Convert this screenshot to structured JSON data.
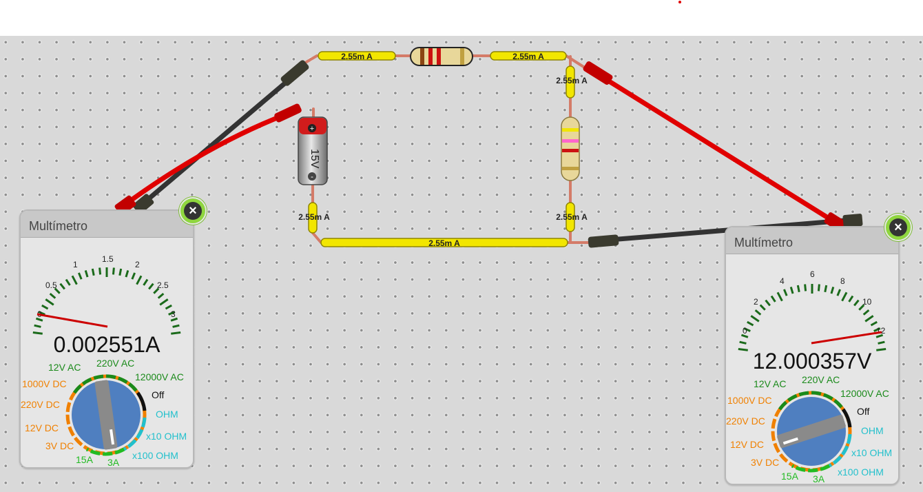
{
  "wires": {
    "top_left": "2.55m A",
    "top_right": "2.55m A",
    "right_upper": "2.55m A",
    "right_lower": "2.55m A",
    "left_lower": "2.55m A",
    "bottom": "2.55m A"
  },
  "battery": {
    "label": "15V",
    "plus": "+",
    "minus": "-"
  },
  "meter_left": {
    "title": "Multímetro",
    "reading": "0.002551A",
    "scale_labels": [
      "0",
      "0.5",
      "1",
      "1.5",
      "2",
      "2.5",
      "3"
    ],
    "ranges": [
      "1000V DC",
      "220V DC",
      "12V DC",
      "3V DC",
      "15A",
      "3A",
      "12V AC",
      "220V AC",
      "12000V AC",
      "Off",
      "OHM",
      "x10 OHM",
      "x100 OHM"
    ],
    "close_icon": "×"
  },
  "meter_right": {
    "title": "Multímetro",
    "reading": "12.000357V",
    "scale_labels": [
      "0",
      "2",
      "4",
      "6",
      "8",
      "10",
      "12"
    ],
    "ranges": [
      "1000V DC",
      "220V DC",
      "12V DC",
      "3V DC",
      "15A",
      "3A",
      "12V AC",
      "220V AC",
      "12000V AC",
      "Off",
      "OHM",
      "x10 OHM",
      "x100 OHM"
    ],
    "close_icon": "×"
  },
  "colors": {
    "wire": "#f2e600",
    "probe_red": "#e00000",
    "probe_black": "#333333",
    "dc_range": "#f08000",
    "amp_range": "#22bb22",
    "ac_range": "#1a8a1a",
    "ohm_range": "#22c0cc",
    "knob": "#4f7fc0"
  }
}
